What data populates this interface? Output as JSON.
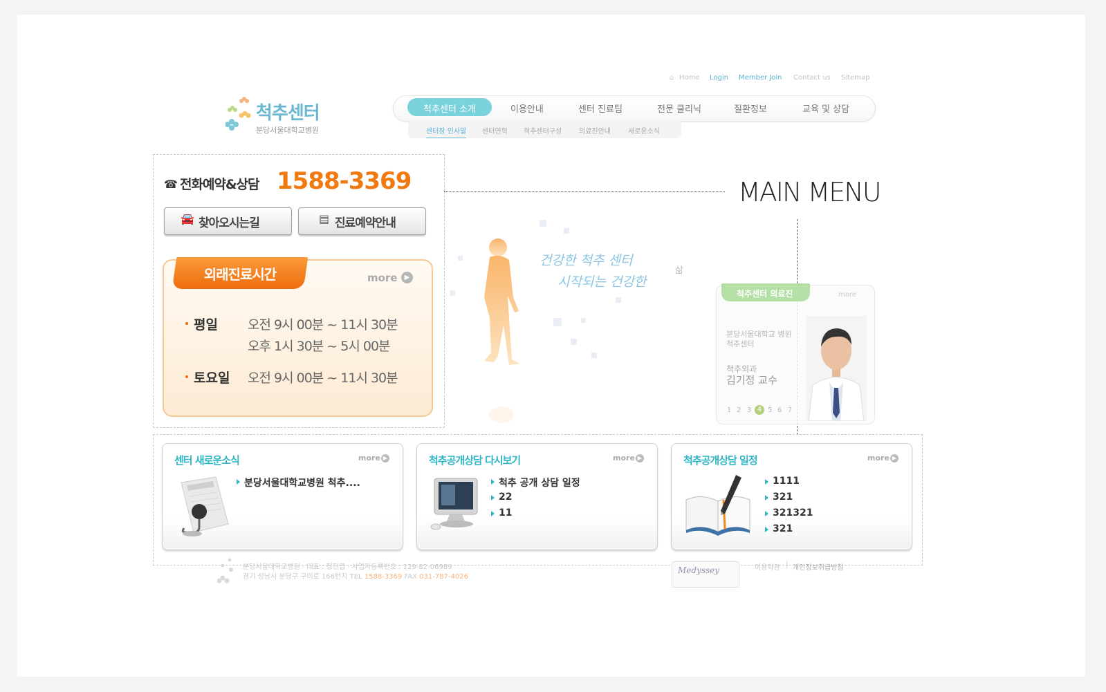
{
  "util_links": [
    {
      "label": "Home",
      "icon": "home-icon"
    },
    {
      "label": "Login"
    },
    {
      "label": "Member Join"
    },
    {
      "label": "Contact us"
    },
    {
      "label": "Sitemap"
    }
  ],
  "logo": {
    "title": "척추센터",
    "subtitle": "분당서울대학교병원"
  },
  "nav": {
    "items": [
      "척추센터 소개",
      "이용안내",
      "센터 진료팀",
      "전문 클리닉",
      "질환정보",
      "교육 및 상담"
    ],
    "active": "척추센터 소개",
    "sub_items": [
      "센터장 인사말",
      "센터연혁",
      "척추센터구성",
      "의료진안내",
      "새로운소식"
    ]
  },
  "reservation": {
    "label": "전화예약&상담",
    "number": "1588-3369"
  },
  "buttons": {
    "directions": "찾아오시는길",
    "booking": "진료예약안내"
  },
  "hours": {
    "title": "외래진료시간",
    "more": "more",
    "weekday_label": "평일",
    "weekday_am": "오전  9시 00분 ~ 11시 30분",
    "weekday_pm": "오후  1시 30분 ~   5시 00분",
    "saturday_label": "토요일",
    "saturday_am": "오전  9시 00분 ~ 11시 30분"
  },
  "annotation": {
    "main_menu": "MAIN MENU"
  },
  "hero": {
    "line1": "건강한 척추 센터",
    "line2": "시작되는 건강한",
    "line3": "삶"
  },
  "doctor": {
    "tab": "척추센터 의료진",
    "more": "more",
    "hospital": "분당서울대학교 병원",
    "center": "척추센터",
    "department": "척추외과",
    "name": "김기정 교수",
    "pages": [
      "1",
      "2",
      "3",
      "4",
      "5",
      "6",
      "7"
    ],
    "active_page": "4"
  },
  "cards": [
    {
      "title": "센터 새로운소식",
      "more": "more",
      "items": [
        "분당서울대학교병원 척추...."
      ]
    },
    {
      "title": "척추공개상담 다시보기",
      "more": "more",
      "items": [
        "척추 공개 상담 일정",
        "22",
        "11"
      ]
    },
    {
      "title": "척추공개상담 일정",
      "more": "more",
      "items": [
        "1111",
        "321",
        "321321",
        "321"
      ]
    }
  ],
  "footer": {
    "line1": "분당서울대학교병원 · 대표 : 정진엽 · 사업자등록번호 : 129-82-06989",
    "line2_prefix": "경기 성남시 분당구 구미로 166번지  TEL ",
    "tel": "1588-3369",
    "fax_label": "  FAX ",
    "fax": "031-787-4026",
    "links": [
      "이용약관",
      "개인정보취급방침"
    ],
    "partner": "Medyssey"
  },
  "colors": {
    "accent": "#2fb5c4",
    "orange": "#f07a10",
    "nav_active": "#7ad3dc",
    "doctor_tab": "#b4dfa5"
  }
}
